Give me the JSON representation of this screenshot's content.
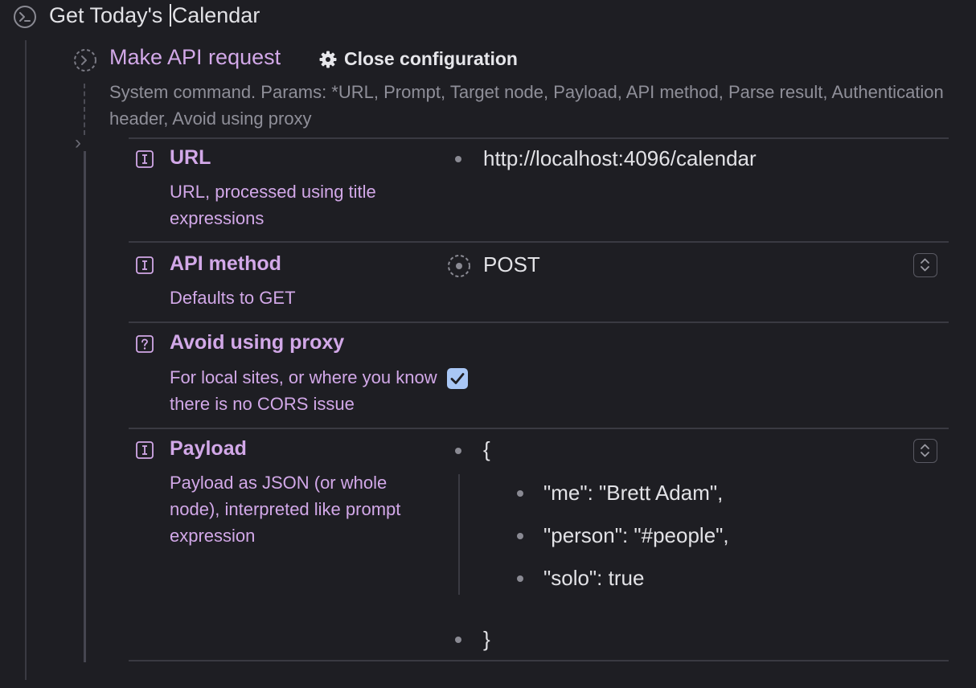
{
  "header": {
    "title_before_cursor": "Get Today's ",
    "title_after_cursor": "Calendar"
  },
  "command": {
    "title": "Make API request",
    "close_config_label": "Close configuration",
    "description": "System command. Params: *URL, Prompt, Target node, Payload, API method, Parse result, Authentication header, Avoid using proxy"
  },
  "params": {
    "url": {
      "name": "URL",
      "description": "URL, processed using title expressions",
      "value": "http://localhost:4096/calendar",
      "icon": "text-field-icon"
    },
    "api_method": {
      "name": "API method",
      "description": "Defaults to GET",
      "value": "POST",
      "icon": "text-field-icon"
    },
    "avoid_proxy": {
      "name": "Avoid using proxy",
      "description": "For local sites, or where you know there is no CORS issue",
      "checked": true,
      "icon": "question-icon"
    },
    "payload": {
      "name": "Payload",
      "description": "Payload as JSON (or whole node), interpreted like prompt expression",
      "icon": "text-field-icon",
      "open": "{",
      "lines": [
        "\"me\": \"Brett Adam\",",
        "\"person\": \"#people\",",
        "\"solo\": true"
      ],
      "close": "}"
    }
  },
  "colors": {
    "background": "#1e1e23",
    "accent": "#d2a8e8",
    "muted_text": "#8f8f99",
    "checkbox": "#a9c7f5"
  }
}
